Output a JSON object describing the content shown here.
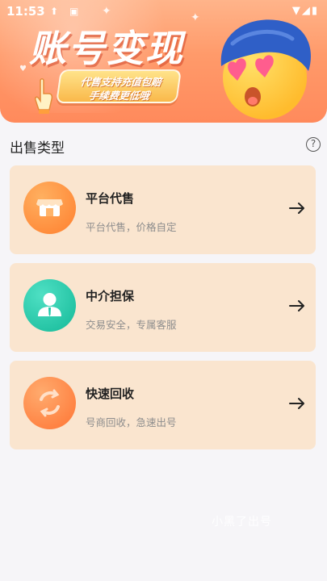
{
  "status_bar": {
    "time": "11:53"
  },
  "banner": {
    "title": "账号变现",
    "pill_line1": "代售支持充值包赔",
    "pill_line2": "手续费更低哦"
  },
  "section": {
    "title": "出售类型"
  },
  "cards": [
    {
      "title": "平台代售",
      "subtitle": "平台代售，价格自定",
      "icon": "store-icon",
      "color": "#ff8a3a"
    },
    {
      "title": "中介担保",
      "subtitle": "交易安全，专属客服",
      "icon": "agent-icon",
      "color": "#1fc8a8"
    },
    {
      "title": "快速回收",
      "subtitle": "号商回收，急速出号",
      "icon": "recycle-icon",
      "color": "#ff7d3b"
    }
  ],
  "watermark": "小黑了出号"
}
